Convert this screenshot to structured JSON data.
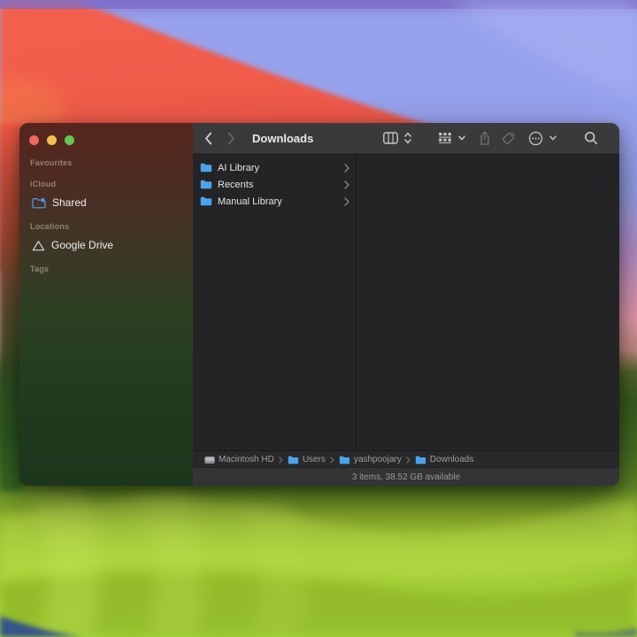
{
  "toolbar": {
    "title": "Downloads",
    "buttons": {
      "back": "chevron-left-icon",
      "forward": "chevron-right-icon",
      "view": "column-view-icon",
      "group": "group-by-icon",
      "share": "share-icon",
      "tag": "tag-icon",
      "more": "ellipsis-circle-icon",
      "search": "search-icon"
    }
  },
  "sidebar": {
    "sections": {
      "favourites": "Favourites",
      "icloud": "iCloud",
      "locations": "Locations",
      "tags": "Tags"
    },
    "items": {
      "shared": "Shared",
      "google_drive": "Google Drive"
    }
  },
  "files": [
    {
      "name": "AI Library",
      "icon": "folder-icon"
    },
    {
      "name": "Recents",
      "icon": "folder-icon"
    },
    {
      "name": "Manual Library",
      "icon": "folder-icon"
    }
  ],
  "pathbar": {
    "items": [
      {
        "label": "Macintosh HD",
        "icon": "hard-drive-icon"
      },
      {
        "label": "Users",
        "icon": "folder-icon"
      },
      {
        "label": "yashpoojary",
        "icon": "folder-icon"
      },
      {
        "label": "Downloads",
        "icon": "folder-icon"
      }
    ]
  },
  "statusbar": {
    "text": "3 items, 38.52 GB available"
  },
  "colors": {
    "folder_blue": "#4aa3ec",
    "traffic_red": "#ec6a5e",
    "traffic_yellow": "#f5bf4f",
    "traffic_green": "#62c554",
    "toolbar_bg": "#3a3a3c",
    "content_bg": "#242426",
    "wallpaper_lime": "#a3cd36",
    "wallpaper_red": "#ee5948",
    "wallpaper_periwinkle": "#96a0ea"
  }
}
